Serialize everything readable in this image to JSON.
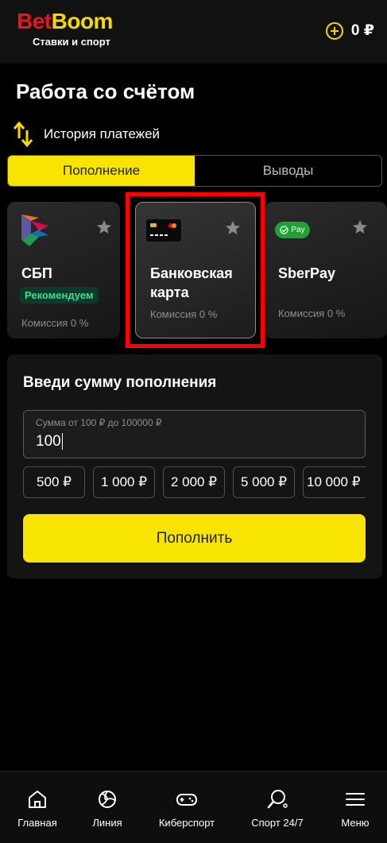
{
  "header": {
    "logo_bet": "Bet",
    "logo_boom": "Boom",
    "logo_subtitle": "Ставки и спорт",
    "balance": "0 ₽",
    "add_funds_icon": "plus-circle-icon"
  },
  "page": {
    "title": "Работа со счётом",
    "history_label": "История платежей"
  },
  "tabs": {
    "deposit": "Пополнение",
    "withdraw": "Выводы",
    "active": "deposit"
  },
  "methods": [
    {
      "name": "СБП",
      "badge": "Рекомендуем",
      "commission": "Комиссия 0 %",
      "icon": "sbp-logo-icon"
    },
    {
      "name_line1": "Банковская",
      "name_line2": "карта",
      "commission": "Комиссия 0 %",
      "icon": "bank-card-icon",
      "selected": true
    },
    {
      "name": "SberPay",
      "commission": "Комиссия 0 %",
      "icon": "sberpay-logo-icon",
      "logo_text": "Pay"
    }
  ],
  "amount": {
    "title": "Введи сумму пополнения",
    "hint": "Сумма от 100 ₽ до 100000 ₽",
    "value": "100",
    "presets": [
      "500 ₽",
      "1 000 ₽",
      "2 000 ₽",
      "5 000 ₽",
      "10 000 ₽"
    ],
    "submit_label": "Пополнить"
  },
  "bottom_nav": [
    {
      "label": "Главная",
      "icon": "home-icon"
    },
    {
      "label": "Линия",
      "icon": "volleyball-icon"
    },
    {
      "label": "Киберспорт",
      "icon": "gamepad-icon"
    },
    {
      "label": "Спорт 24/7",
      "icon": "ping-pong-icon"
    },
    {
      "label": "Меню",
      "icon": "menu-icon"
    }
  ],
  "colors": {
    "accent_yellow": "#f7e400",
    "logo_red": "#e8141e",
    "recommend_green": "#3fdb92",
    "highlight_red": "#ff0000"
  }
}
